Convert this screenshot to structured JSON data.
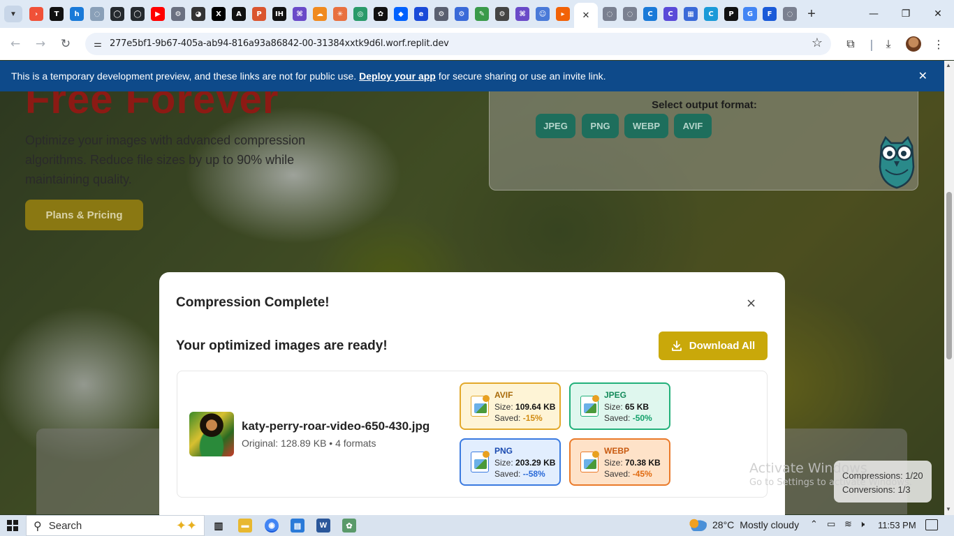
{
  "browser": {
    "url": "277e5bf1-9b67-405a-ab94-816a93a86842-00-31384xxtk9d6l.worf.replit.dev",
    "pinned_tabs": [
      {
        "icon": "swift-icon",
        "color": "#f05138",
        "glyph": "›"
      },
      {
        "icon": "trello-icon",
        "color": "#111111",
        "glyph": "T"
      },
      {
        "icon": "h-icon",
        "color": "#1a7ad8",
        "glyph": "h"
      },
      {
        "icon": "globe-icon",
        "color": "#8aa0b8",
        "glyph": "◌"
      },
      {
        "icon": "github-icon",
        "color": "#24292e",
        "glyph": "◯"
      },
      {
        "icon": "github-icon",
        "color": "#24292e",
        "glyph": "◯"
      },
      {
        "icon": "youtube-icon",
        "color": "#ff0000",
        "glyph": "▶"
      },
      {
        "icon": "gear-site-icon",
        "color": "#6a7080",
        "glyph": "⚙"
      },
      {
        "icon": "panda-icon",
        "color": "#333333",
        "glyph": "◕"
      },
      {
        "icon": "x-icon",
        "color": "#000000",
        "glyph": "X"
      },
      {
        "icon": "anthropic-icon",
        "color": "#111111",
        "glyph": "A"
      },
      {
        "icon": "producthunt-icon",
        "color": "#da552f",
        "glyph": "P"
      },
      {
        "icon": "ih-icon",
        "color": "#111111",
        "glyph": "IH"
      },
      {
        "icon": "grid-icon",
        "color": "#6a4ac8",
        "glyph": "⌘"
      },
      {
        "icon": "cloud-icon",
        "color": "#f08a20",
        "glyph": "☁"
      },
      {
        "icon": "sun-icon",
        "color": "#e87040",
        "glyph": "✳"
      },
      {
        "icon": "circle-icon",
        "color": "#2a9a6a",
        "glyph": "◎"
      },
      {
        "icon": "openai-icon",
        "color": "#111111",
        "glyph": "✿"
      },
      {
        "icon": "dropbox-icon",
        "color": "#0061fe",
        "glyph": "◆"
      },
      {
        "icon": "e-icon",
        "color": "#1a4ad8",
        "glyph": "e"
      },
      {
        "icon": "gear-site-icon",
        "color": "#5a6070",
        "glyph": "⚙"
      },
      {
        "icon": "shield-icon",
        "color": "#3a6ad8",
        "glyph": "⚙"
      },
      {
        "icon": "pencil-icon",
        "color": "#3a9a4a",
        "glyph": "✎"
      },
      {
        "icon": "settings-icon",
        "color": "#444444",
        "glyph": "⚙"
      },
      {
        "icon": "grid-icon",
        "color": "#6a4ac8",
        "glyph": "⌘"
      },
      {
        "icon": "robot-icon",
        "color": "#4a7ad8",
        "glyph": "☺"
      },
      {
        "icon": "replit-icon",
        "color": "#f26207",
        "glyph": "▸"
      }
    ],
    "right_tabs": [
      {
        "icon": "globe-icon",
        "color": "#7a8090",
        "glyph": "◌"
      },
      {
        "icon": "globe-icon",
        "color": "#7a8090",
        "glyph": "◌"
      },
      {
        "icon": "c-icon",
        "color": "#1a7ad8",
        "glyph": "C"
      },
      {
        "icon": "c-icon",
        "color": "#5a4ad8",
        "glyph": "C"
      },
      {
        "icon": "calendar-icon",
        "color": "#3a6ad8",
        "glyph": "▦"
      },
      {
        "icon": "c-icon",
        "color": "#1a9ad8",
        "glyph": "C"
      },
      {
        "icon": "p-icon",
        "color": "#111111",
        "glyph": "P"
      },
      {
        "icon": "google-icon",
        "color": "#4285f4",
        "glyph": "G"
      },
      {
        "icon": "forms-icon",
        "color": "#1a5ad8",
        "glyph": "F"
      },
      {
        "icon": "globe-icon",
        "color": "#7a8090",
        "glyph": "◌"
      }
    ],
    "window_controls": {
      "minimize": "—",
      "restore": "❐",
      "close": "✕"
    }
  },
  "banner": {
    "text_before": "This is a temporary development preview, and these links are not for public use.",
    "link": "Deploy your app",
    "text_after": "for secure sharing or use an invite link."
  },
  "hero": {
    "title": "Free Forever",
    "description": "Optimize your images with advanced compression algorithms. Reduce file sizes by up to 90% while maintaining quality.",
    "plans_button": "Plans & Pricing"
  },
  "format_panel": {
    "label": "Select output format:",
    "formats": [
      "JPEG",
      "PNG",
      "WEBP",
      "AVIF"
    ]
  },
  "modal": {
    "title": "Compression Complete!",
    "close": "×",
    "subtitle": "Your optimized images are ready!",
    "download_all": "Download All",
    "file": {
      "name": "katy-perry-roar-video-650-430.jpg",
      "meta": "Original: 128.89 KB • 4 formats"
    },
    "results": [
      {
        "format": "AVIF",
        "size": "109.64 KB",
        "saved": "-15%",
        "bg": "#fef4d6",
        "border": "#e2a82a",
        "name_color": "#a86a0a",
        "saved_color": "#d08a10"
      },
      {
        "format": "JPEG",
        "size": "65 KB",
        "saved": "-50%",
        "bg": "#dff7ee",
        "border": "#22b07a",
        "name_color": "#138a5a",
        "saved_color": "#12a06a"
      },
      {
        "format": "PNG",
        "size": "203.29 KB",
        "saved": "--58%",
        "bg": "#e2eefe",
        "border": "#3a7ae0",
        "name_color": "#1a4ab0",
        "saved_color": "#2a6ad8"
      },
      {
        "format": "WEBP",
        "size": "70.38 KB",
        "saved": "-45%",
        "bg": "#fee2c8",
        "border": "#ea7a2a",
        "name_color": "#c85a10",
        "saved_color": "#e06a10"
      }
    ],
    "size_label": "Size:",
    "saved_label": "Saved:"
  },
  "stats": {
    "compressions": "Compressions: 1/20",
    "conversions": "Conversions: 1/3"
  },
  "watermark": {
    "title": "Activate Windows",
    "subtitle": "Go to Settings to activate Windows."
  },
  "taskbar": {
    "search_placeholder": "Search",
    "temperature": "28°C",
    "weather": "Mostly cloudy",
    "time": "11:53 PM"
  }
}
